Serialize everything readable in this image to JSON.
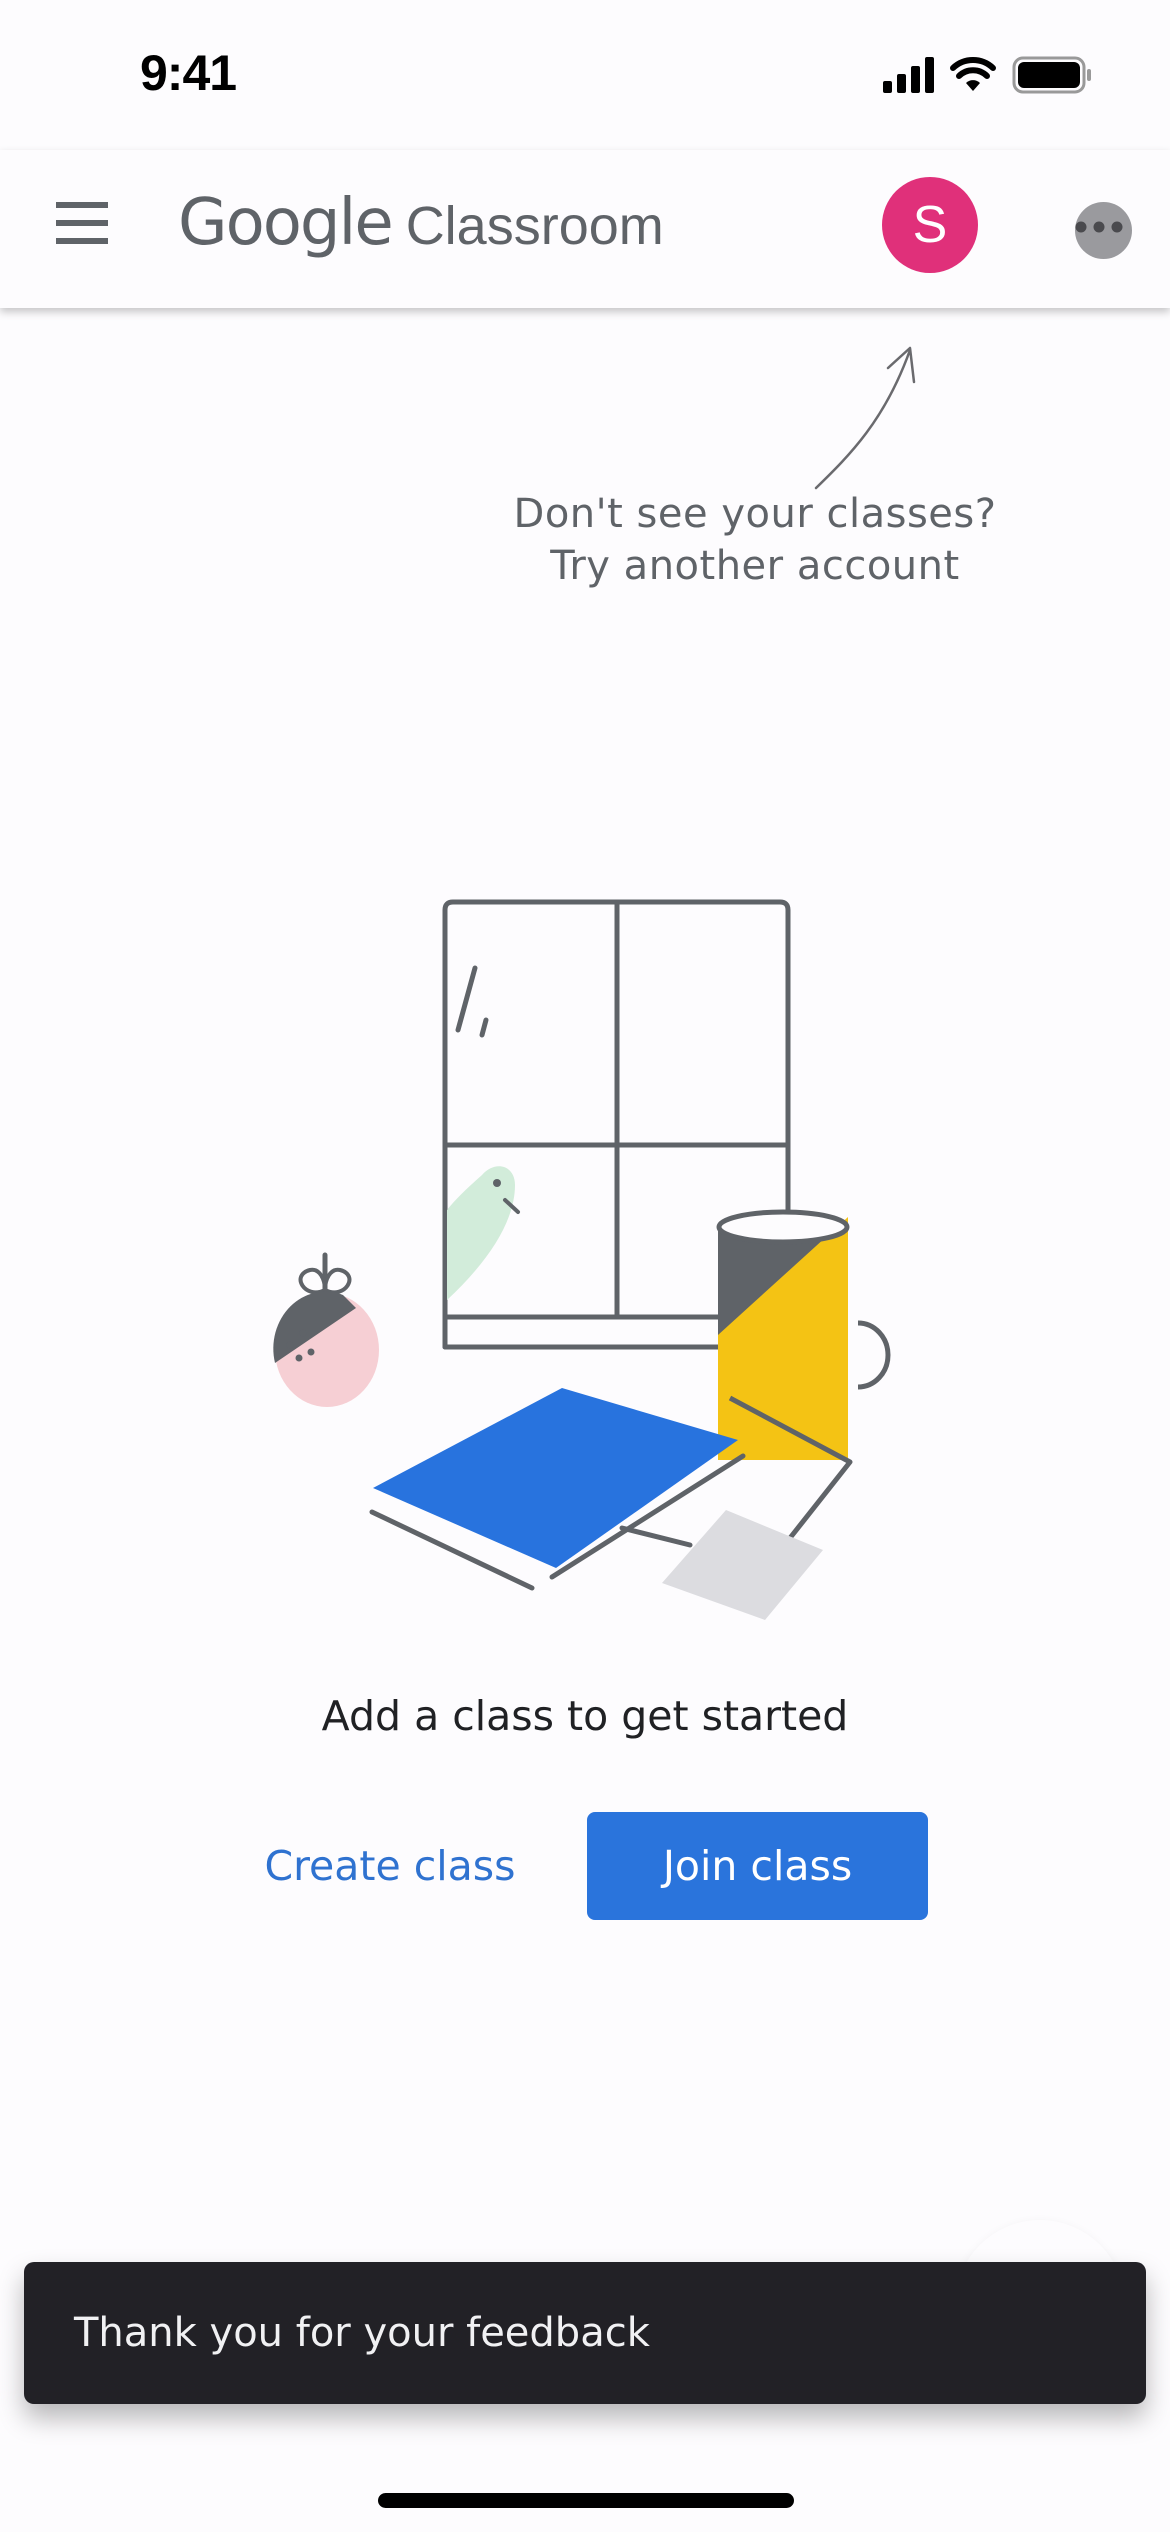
{
  "status_bar": {
    "time": "9:41",
    "icons": [
      "cellular-signal-icon",
      "wifi-icon",
      "battery-icon"
    ]
  },
  "header": {
    "menu_icon": "hamburger-menu-icon",
    "brand_google": "Google",
    "brand_product": "Classroom",
    "avatar_initial": "S",
    "more_icon": "more-horizontal-icon"
  },
  "colors": {
    "avatar": "#e0307a",
    "primary": "#2a74dc",
    "link": "#2f72d0",
    "snackbar_bg": "#222126",
    "illustration_blue": "#2873de",
    "illustration_yellow": "#f4c314",
    "illustration_pink": "#f6cfd4",
    "illustration_green": "#d2ecda",
    "illustration_stroke": "#5f6368"
  },
  "hint": {
    "line1": "Don't see your classes?",
    "line2": "Try another account"
  },
  "empty_state": {
    "illustration": "window-desk-illustration",
    "title": "Add a class to get started",
    "create_label": "Create class",
    "join_label": "Join class"
  },
  "snackbar": {
    "message": "Thank you for your feedback"
  }
}
